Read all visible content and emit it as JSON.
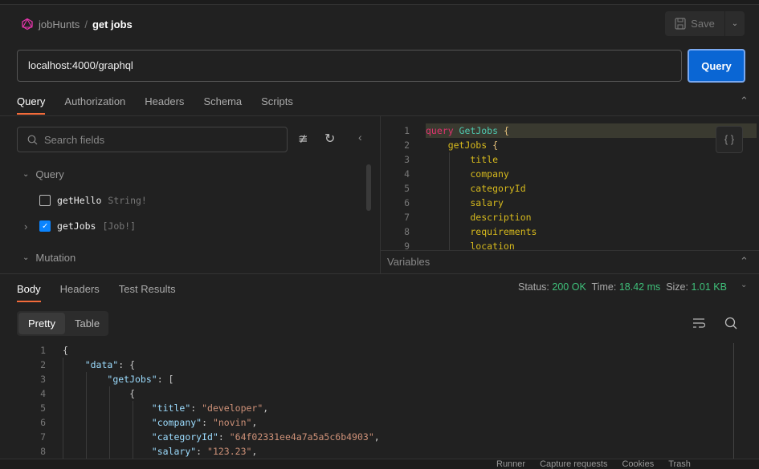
{
  "breadcrumb": {
    "collection": "jobHunts",
    "separator": "/",
    "request": "get jobs"
  },
  "toolbar": {
    "save_label": "Save"
  },
  "url": {
    "value": "localhost:4000/graphql"
  },
  "query_button": "Query",
  "request_tabs": [
    "Query",
    "Authorization",
    "Headers",
    "Schema",
    "Scripts"
  ],
  "explorer": {
    "search_placeholder": "Search fields",
    "sections": {
      "query": "Query",
      "mutation": "Mutation"
    },
    "fields": [
      {
        "name": "getHello",
        "type": "String!",
        "checked": false
      },
      {
        "name": "getJobs",
        "type": "[Job!]",
        "checked": true
      }
    ]
  },
  "editor": {
    "lines": [
      [
        [
          "query ",
          "#e0336e"
        ],
        [
          "GetJobs",
          "#4ec9b0"
        ],
        [
          " {",
          "#e5c07b"
        ]
      ],
      [
        [
          "    getJobs ",
          "#d7ba1d"
        ],
        [
          "{",
          "#e5c07b"
        ]
      ],
      [
        [
          "        title",
          "#d7ba1d"
        ]
      ],
      [
        [
          "        company",
          "#d7ba1d"
        ]
      ],
      [
        [
          "        categoryId",
          "#d7ba1d"
        ]
      ],
      [
        [
          "        salary",
          "#d7ba1d"
        ]
      ],
      [
        [
          "        description",
          "#d7ba1d"
        ]
      ],
      [
        [
          "        requirements",
          "#d7ba1d"
        ]
      ],
      [
        [
          "        location",
          "#d7ba1d"
        ]
      ]
    ]
  },
  "variables_label": "Variables",
  "response_tabs": [
    "Body",
    "Headers",
    "Test Results"
  ],
  "status": {
    "status_label": "Status:",
    "status": "200 OK",
    "time_label": "Time:",
    "time": "18.42 ms",
    "size_label": "Size:",
    "size": "1.01 KB"
  },
  "view_modes": [
    "Pretty",
    "Table"
  ],
  "response": {
    "lines": [
      [
        [
          "{",
          "p"
        ]
      ],
      [
        [
          "    ",
          "p"
        ],
        [
          "\"data\"",
          "k"
        ],
        [
          ": {",
          "p"
        ]
      ],
      [
        [
          "        ",
          "p"
        ],
        [
          "\"getJobs\"",
          "k"
        ],
        [
          ": [",
          "p"
        ]
      ],
      [
        [
          "            {",
          "p"
        ]
      ],
      [
        [
          "                ",
          "p"
        ],
        [
          "\"title\"",
          "k"
        ],
        [
          ": ",
          "p"
        ],
        [
          "\"developer\"",
          "s"
        ],
        [
          ",",
          "p"
        ]
      ],
      [
        [
          "                ",
          "p"
        ],
        [
          "\"company\"",
          "k"
        ],
        [
          ": ",
          "p"
        ],
        [
          "\"novin\"",
          "s"
        ],
        [
          ",",
          "p"
        ]
      ],
      [
        [
          "                ",
          "p"
        ],
        [
          "\"categoryId\"",
          "k"
        ],
        [
          ": ",
          "p"
        ],
        [
          "\"64f02331ee4a7a5a5c6b4903\"",
          "s"
        ],
        [
          ",",
          "p"
        ]
      ],
      [
        [
          "                ",
          "p"
        ],
        [
          "\"salary\"",
          "k"
        ],
        [
          ": ",
          "p"
        ],
        [
          "\"123.23\"",
          "s"
        ],
        [
          ",",
          "p"
        ]
      ]
    ]
  },
  "footer": [
    "Runner",
    "Capture requests",
    "Cookies",
    "Trash"
  ],
  "colors": {
    "accent": "#f26b3a",
    "primary": "#0a66d4",
    "success": "#3fc07a",
    "graphql": "#e535ab"
  }
}
